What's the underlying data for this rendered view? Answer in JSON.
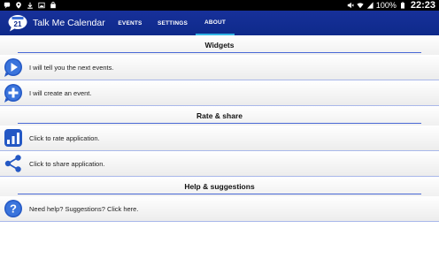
{
  "status_bar": {
    "time": "22:23",
    "battery_percent": "100%"
  },
  "app": {
    "logo_number": "21",
    "title": "Talk Me Calendar",
    "tabs": [
      {
        "label": "EVENTS",
        "selected": false
      },
      {
        "label": "SETTINGS",
        "selected": false
      },
      {
        "label": "ABOUT",
        "selected": true
      }
    ],
    "accent_color": "#17309a",
    "tab_indicator_color": "#33b5e5"
  },
  "sections": [
    {
      "title": "Widgets",
      "rows": [
        {
          "text": "I will tell you the next events.",
          "icon": "play-icon"
        },
        {
          "text": "I will create an event.",
          "icon": "plus-icon"
        }
      ]
    },
    {
      "title": "Rate & share",
      "rows": [
        {
          "text": "Click to rate application.",
          "icon": "bar-chart-icon"
        },
        {
          "text": "Click to share application.",
          "icon": "share-icon"
        }
      ]
    },
    {
      "title": "Help & suggestions",
      "rows": [
        {
          "text": "Need help? Suggestions? Click here.",
          "icon": "help-icon"
        }
      ]
    }
  ]
}
